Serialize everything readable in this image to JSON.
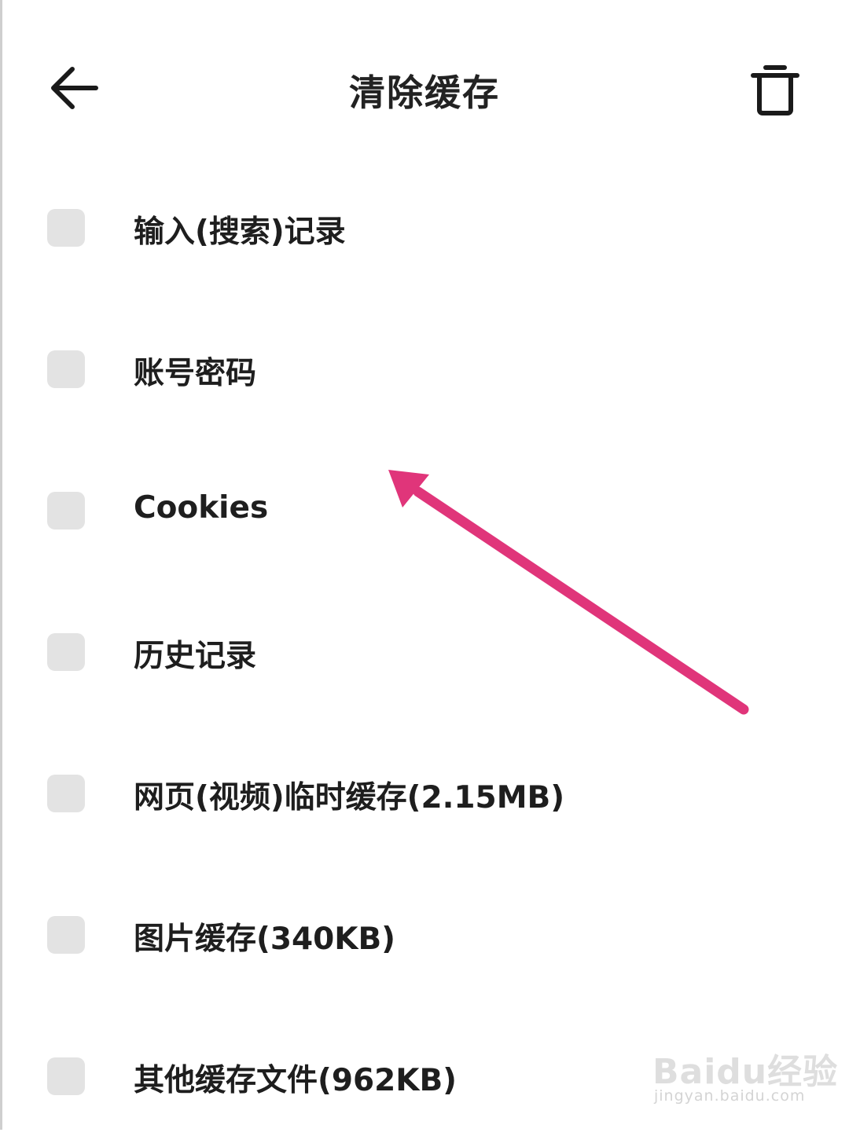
{
  "header": {
    "title": "清除缓存",
    "back_icon": "arrow-left-icon",
    "delete_icon": "trash-icon"
  },
  "options": [
    {
      "label": "输入(搜索)记录",
      "checked": false
    },
    {
      "label": "账号密码",
      "checked": false
    },
    {
      "label": "Cookies",
      "checked": false
    },
    {
      "label": "历史记录",
      "checked": false
    },
    {
      "label": "网页(视频)临时缓存(2.15MB)",
      "checked": false
    },
    {
      "label": "图片缓存(340KB)",
      "checked": false
    },
    {
      "label": "其他缓存文件(962KB)",
      "checked": false
    }
  ],
  "annotation": {
    "arrow_color": "#e0357a"
  },
  "watermark": {
    "brand": "Baidu经验",
    "url": "jingyan.baidu.com"
  },
  "colors": {
    "background": "#ffffff",
    "checkbox": "#e3e3e3",
    "text": "#1e1e1e"
  }
}
